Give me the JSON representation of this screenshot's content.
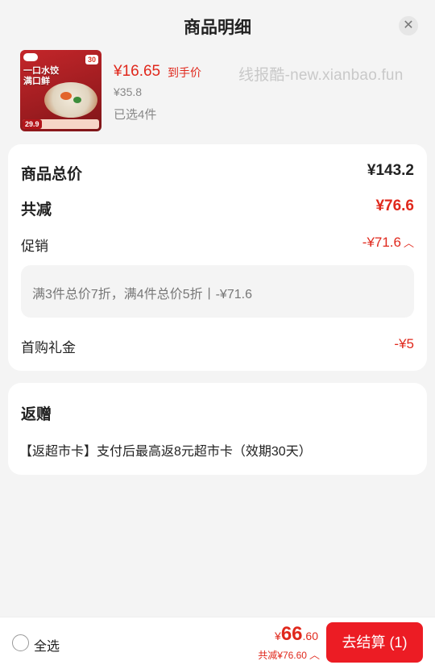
{
  "header": {
    "title": "商品明细",
    "close_icon": "close-icon"
  },
  "product": {
    "thumb_overlay": {
      "brand_tag": "",
      "count": "30",
      "headline_l1": "一口水饺",
      "headline_l2": "满口鲜",
      "price": "29.9"
    },
    "price_now": "¥16.65",
    "price_tag": "到手价",
    "price_orig": "¥35.8",
    "selected": "已选4件",
    "watermark": "线报酷-new.xianbao.fun"
  },
  "summary": {
    "total_label": "商品总价",
    "total_value": "¥143.2",
    "discount_label": "共减",
    "discount_value": "¥76.6",
    "promo_label": "促销",
    "promo_value": "-¥71.6",
    "promo_detail": "满3件总价7折，满4件总价5折丨-¥71.6",
    "first_gift_label": "首购礼金",
    "first_gift_value": "-¥5"
  },
  "gift": {
    "title": "返赠",
    "desc": "【返超市卡】支付后最高返8元超市卡（效期30天）"
  },
  "footer": {
    "select_all": "全选",
    "yen": "¥",
    "price_int": "66",
    "price_dec": ".60",
    "saving": "共减¥76.60",
    "checkout": "去结算 (1)"
  },
  "colors": {
    "accent": "#e0281c",
    "button": "#ec1c24",
    "bg": "#f4f4f4"
  }
}
